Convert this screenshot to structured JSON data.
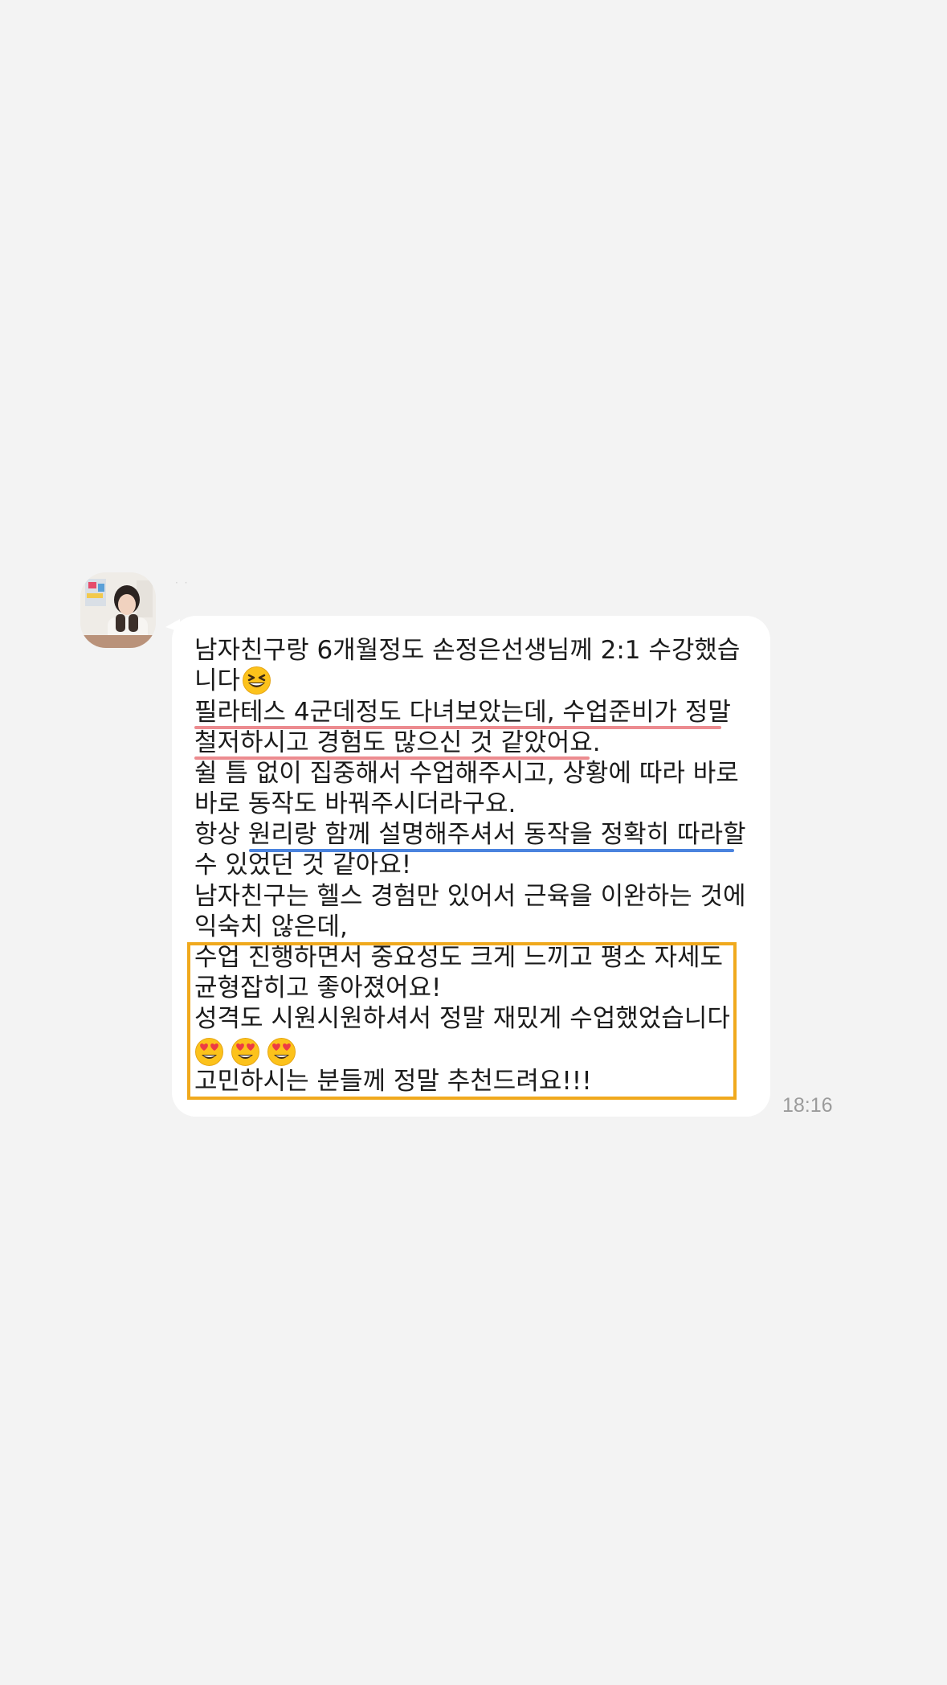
{
  "chat": {
    "timestamp": "18:16",
    "message_lines": [
      "남자친구랑 6개월정도  손정은선생님께 2:1 수강했습",
      "니다",
      "필라테스 4군데정도 다녀보았는데, 수업준비가 정말",
      "철저하시고 경험도 많으신 것 같았어요.",
      "쉴 틈 없이 집중해서 수업해주시고, 상황에 따라 바로",
      "바로 동작도 바꿔주시더라구요.",
      "항상 원리랑 함께 설명해주셔서 동작을 정확히 따라할",
      "수 있었던 것 같아요!",
      "남자친구는 헬스 경험만 있어서 근육을 이완하는 것에",
      "익숙치 않은데,",
      "수업 진행하면서 중요성도 크게 느끼고 평소 자세도",
      "균형잡히고 좋아졌어요!",
      "성격도 시원시원하셔서 정말 재밌게 수업했었습니다",
      "",
      "고민하시는 분들께 정말 추천드려요!!!"
    ],
    "emojis": {
      "line2": "grinning-squinting-face-icon",
      "line14": [
        "heart-eyes-face-icon",
        "heart-eyes-face-icon",
        "heart-eyes-face-icon"
      ]
    },
    "annotation_colors": {
      "red_underline": "#ec8b8f",
      "blue_underline": "#4a83de",
      "highlight_box": "#f0a91d"
    }
  }
}
